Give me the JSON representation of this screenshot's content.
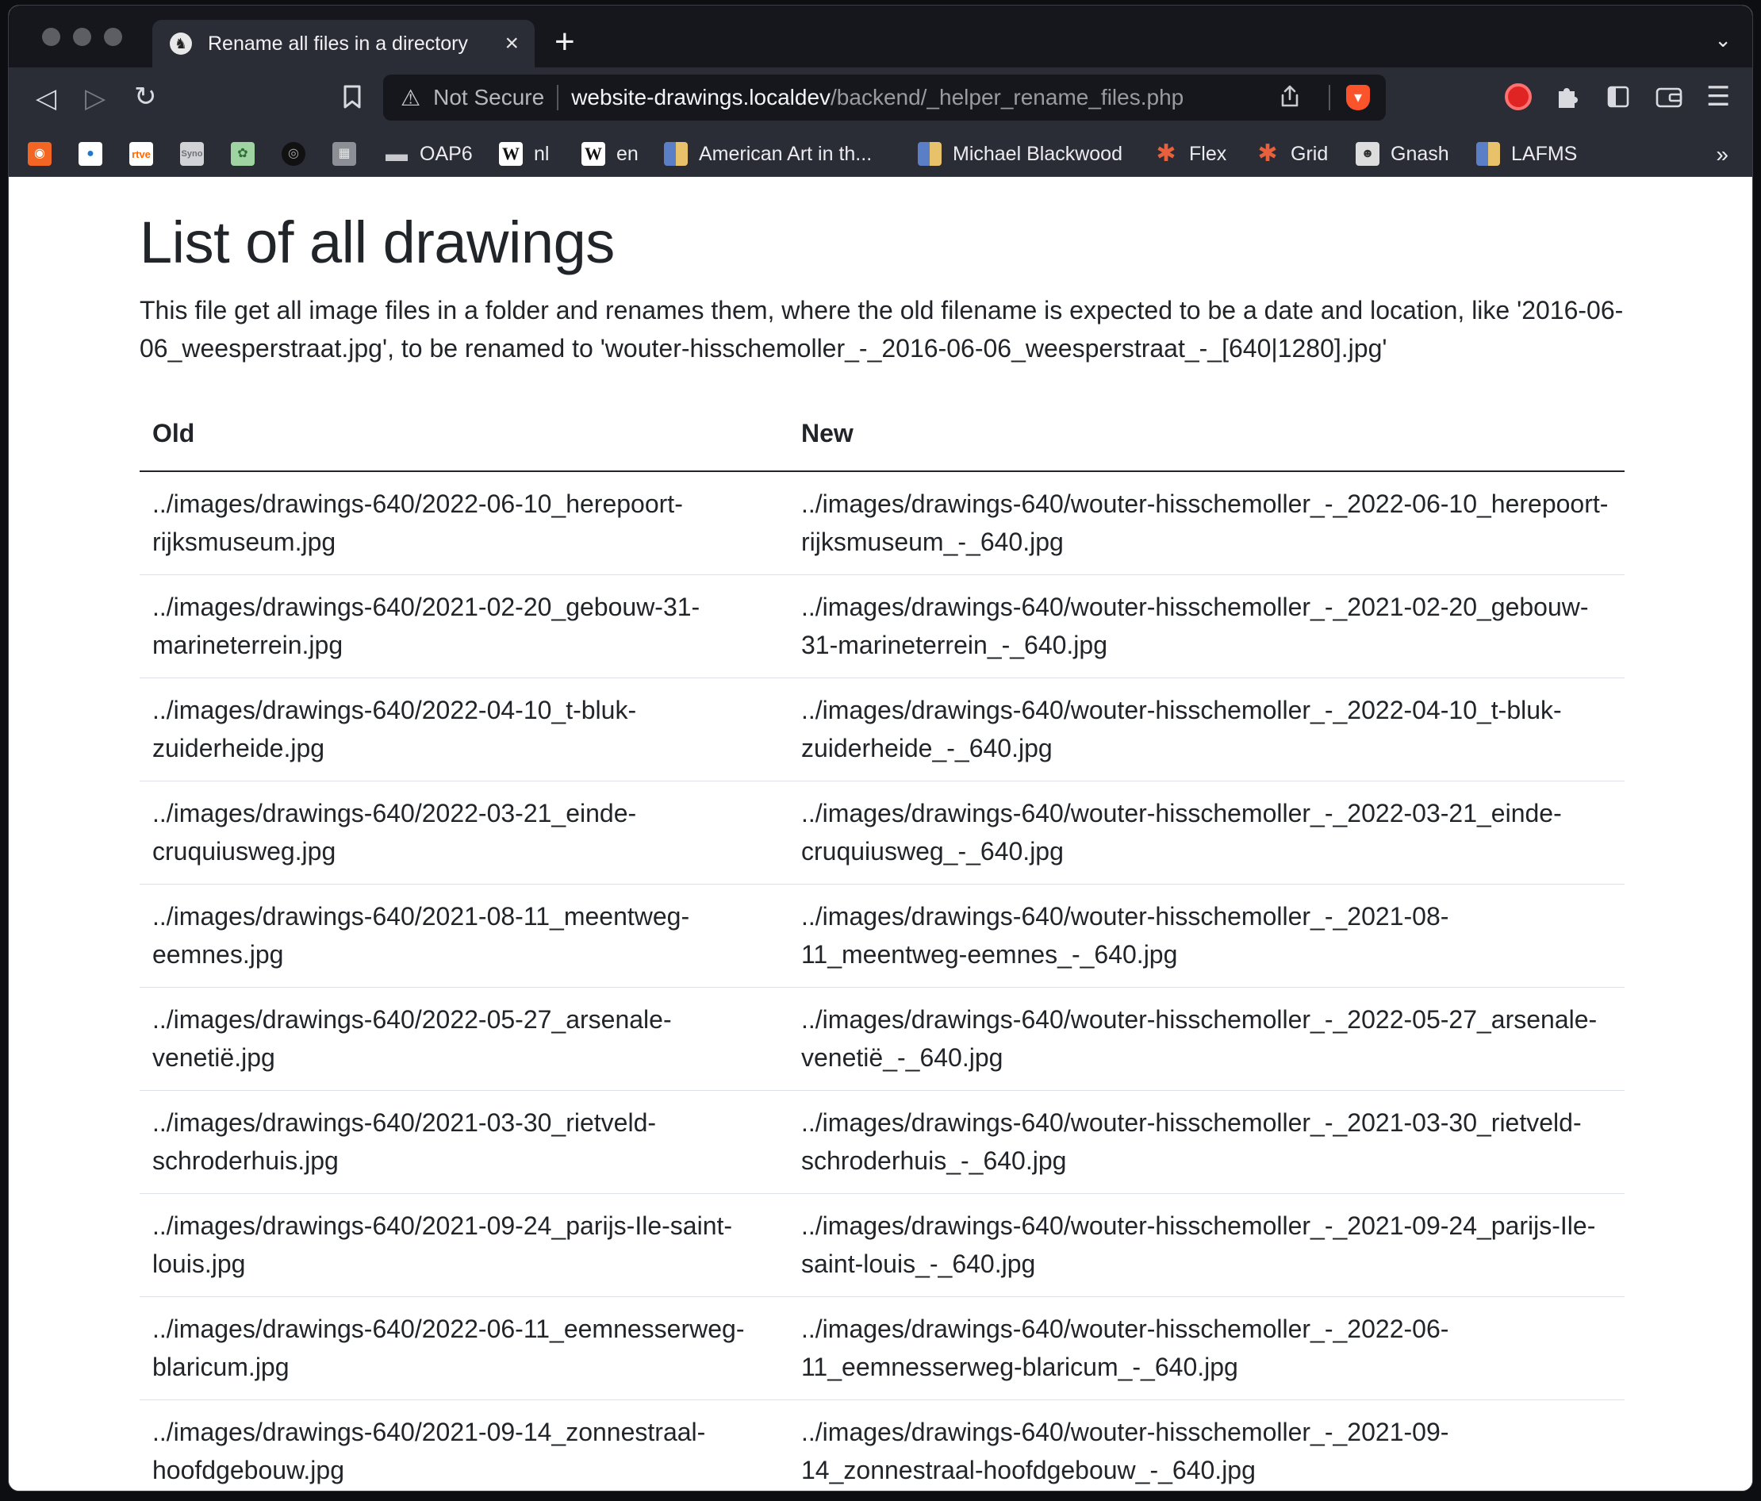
{
  "tab": {
    "title": "Rename all files in a directory",
    "close_glyph": "×",
    "new_tab_glyph": "+",
    "list_glyph": "⌄"
  },
  "toolbar": {
    "back_glyph": "◁",
    "forward_glyph": "▷",
    "reload_glyph": "↻",
    "bookmark_glyph": "🔖",
    "menu_glyph": "☰"
  },
  "address": {
    "security_icon": "⚠",
    "security_label": "Not Secure",
    "host": "website-drawings.localdev",
    "path": "/backend/_helper_rename_files.php"
  },
  "bookmarks": {
    "items": [
      {
        "label": "",
        "icon": "rss-icon",
        "color": "#f26522"
      },
      {
        "label": "",
        "icon": "camera-icon",
        "color": "#1f77d0"
      },
      {
        "label": "",
        "icon": "rtve-icon",
        "color": "#ff6a00"
      },
      {
        "label": "",
        "icon": "synology-icon",
        "color": "#9aa0a6"
      },
      {
        "label": "",
        "icon": "map-icon",
        "color": "#6fbf73"
      },
      {
        "label": "",
        "icon": "record-icon",
        "color": "#222222"
      },
      {
        "label": "",
        "icon": "building-icon",
        "color": "#8c8f96"
      },
      {
        "label": "OAP6",
        "icon": "folder-icon",
        "color": "#c9cad0"
      },
      {
        "label": "nl",
        "icon": "wikipedia-icon",
        "color": "#ffffff"
      },
      {
        "label": "en",
        "icon": "wikipedia-icon",
        "color": "#ffffff"
      },
      {
        "label": "American Art in th...",
        "icon": "grid-favicon-icon",
        "color": "#5b7fc7"
      },
      {
        "label": "Michael Blackwood",
        "icon": "grid-favicon-icon",
        "color": "#5b7fc7"
      },
      {
        "label": "Flex",
        "icon": "asterisk-icon",
        "color": "#e8603c"
      },
      {
        "label": "Grid",
        "icon": "asterisk-icon",
        "color": "#e8603c"
      },
      {
        "label": "Gnash",
        "icon": "gnash-icon",
        "color": "#dddddd"
      },
      {
        "label": "LAFMS",
        "icon": "grid-favicon-icon",
        "color": "#5b7fc7"
      }
    ],
    "more_glyph": "»"
  },
  "page": {
    "heading": "List of all drawings",
    "description": "This file get all image files in a folder and renames them, where the old filename is expected to be a date and location, like '2016-06-06_weesperstraat.jpg', to be renamed to 'wouter-hisschemoller_-_2016-06-06_weesperstraat_-_[640|1280].jpg'"
  },
  "table": {
    "headers": [
      "Old",
      "New"
    ],
    "rows": [
      [
        "../images/drawings-640/2022-06-10_herepoort-rijksmuseum.jpg",
        "../images/drawings-640/wouter-hisschemoller_-_2022-06-10_herepoort-rijksmuseum_-_640.jpg"
      ],
      [
        "../images/drawings-640/2021-02-20_gebouw-31-marineterrein.jpg",
        "../images/drawings-640/wouter-hisschemoller_-_2021-02-20_gebouw-31-marineterrein_-_640.jpg"
      ],
      [
        "../images/drawings-640/2022-04-10_t-bluk-zuiderheide.jpg",
        "../images/drawings-640/wouter-hisschemoller_-_2022-04-10_t-bluk-zuiderheide_-_640.jpg"
      ],
      [
        "../images/drawings-640/2022-03-21_einde-cruquiusweg.jpg",
        "../images/drawings-640/wouter-hisschemoller_-_2022-03-21_einde-cruquiusweg_-_640.jpg"
      ],
      [
        "../images/drawings-640/2021-08-11_meentweg-eemnes.jpg",
        "../images/drawings-640/wouter-hisschemoller_-_2021-08-11_meentweg-eemnes_-_640.jpg"
      ],
      [
        "../images/drawings-640/2022-05-27_arsenale-venetië.jpg",
        "../images/drawings-640/wouter-hisschemoller_-_2022-05-27_arsenale-venetië_-_640.jpg"
      ],
      [
        "../images/drawings-640/2021-03-30_rietveld-schroderhuis.jpg",
        "../images/drawings-640/wouter-hisschemoller_-_2021-03-30_rietveld-schroderhuis_-_640.jpg"
      ],
      [
        "../images/drawings-640/2021-09-24_parijs-Ile-saint-louis.jpg",
        "../images/drawings-640/wouter-hisschemoller_-_2021-09-24_parijs-Ile-saint-louis_-_640.jpg"
      ],
      [
        "../images/drawings-640/2022-06-11_eemnesserweg-blaricum.jpg",
        "../images/drawings-640/wouter-hisschemoller_-_2022-06-11_eemnesserweg-blaricum_-_640.jpg"
      ],
      [
        "../images/drawings-640/2021-09-14_zonnestraal-hoofdgebouw.jpg",
        "../images/drawings-640/wouter-hisschemoller_-_2021-09-14_zonnestraal-hoofdgebouw_-_640.jpg"
      ]
    ]
  }
}
